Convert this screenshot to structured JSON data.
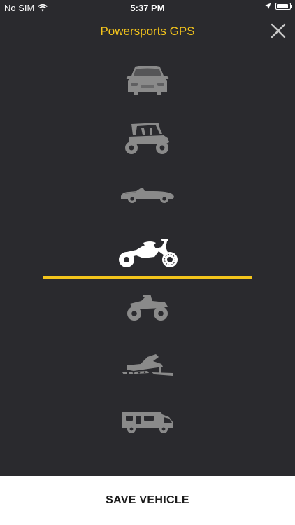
{
  "status_bar": {
    "carrier": "No SIM",
    "time": "5:37 PM",
    "battery_level": 0.9
  },
  "header": {
    "title": "Powersports GPS",
    "close_icon": "close-icon"
  },
  "vehicles": [
    {
      "icon": "car-icon",
      "selected": false
    },
    {
      "icon": "utv-side-by-side-icon",
      "selected": false
    },
    {
      "icon": "classic-convertible-icon",
      "selected": false
    },
    {
      "icon": "motorcycle-icon",
      "selected": true
    },
    {
      "icon": "atv-quad-icon",
      "selected": false
    },
    {
      "icon": "snowmobile-icon",
      "selected": false
    },
    {
      "icon": "rv-motorhome-icon",
      "selected": false
    }
  ],
  "colors": {
    "background": "#2a2a2e",
    "accent": "#f4c51c",
    "icon_inactive": "#8a8a8a",
    "icon_active": "#ffffff"
  },
  "footer": {
    "save_label": "SAVE VEHICLE"
  }
}
